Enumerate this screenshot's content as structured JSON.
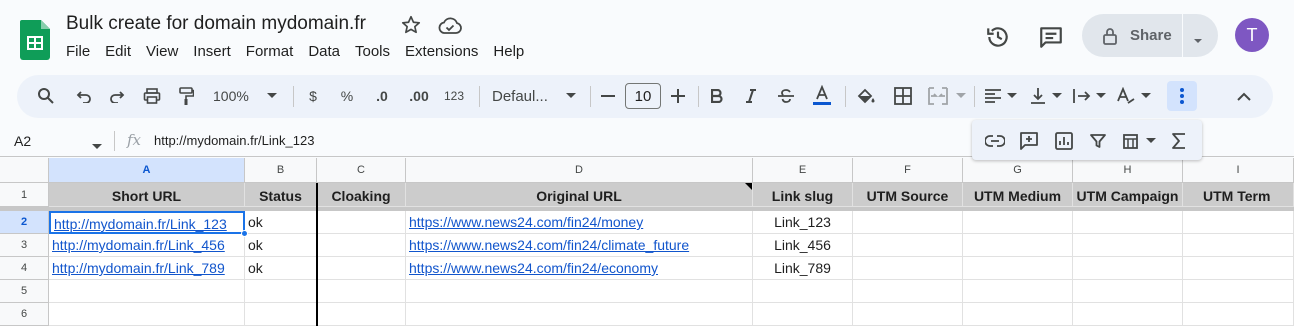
{
  "document": {
    "title": "Bulk create for domain mydomain.fr"
  },
  "menu": [
    "File",
    "Edit",
    "View",
    "Insert",
    "Format",
    "Data",
    "Tools",
    "Extensions",
    "Help"
  ],
  "header": {
    "share_label": "Share",
    "avatar_letter": "T"
  },
  "toolbar": {
    "zoom": "100%",
    "currency": "$",
    "percent": "%",
    "dec_decrease": ".0",
    "dec_increase": ".00",
    "number_format": "123",
    "font": "Defaul...",
    "font_size": "10"
  },
  "formula_bar": {
    "cell_ref": "A2",
    "fx": "fx",
    "value": "http://mydomain.fr/Link_123"
  },
  "sheet": {
    "columns": [
      "A",
      "B",
      "C",
      "D",
      "E",
      "F",
      "G",
      "H",
      "I"
    ],
    "rows": [
      "1",
      "2",
      "3",
      "4",
      "5",
      "6"
    ],
    "headers": [
      "Short URL",
      "Status",
      "Cloaking",
      "Original URL",
      "Link slug",
      "UTM Source",
      "UTM Medium",
      "UTM Campaign",
      "UTM Term"
    ],
    "data": [
      {
        "short_url": "http://mydomain.fr/Link_123",
        "status": "ok",
        "cloaking": "",
        "original_url": "https://www.news24.com/fin24/money",
        "slug": "Link_123"
      },
      {
        "short_url": "http://mydomain.fr/Link_456",
        "status": "ok",
        "cloaking": "",
        "original_url": "https://www.news24.com/fin24/climate_future",
        "slug": "Link_456"
      },
      {
        "short_url": "http://mydomain.fr/Link_789",
        "status": "ok",
        "cloaking": "",
        "original_url": "https://www.news24.com/fin24/economy",
        "slug": "Link_789"
      }
    ]
  },
  "colors": {
    "accent": "#0b57d0",
    "link": "#1155cc",
    "logo_green": "#0f9d58",
    "avatar": "#7e57c2"
  }
}
